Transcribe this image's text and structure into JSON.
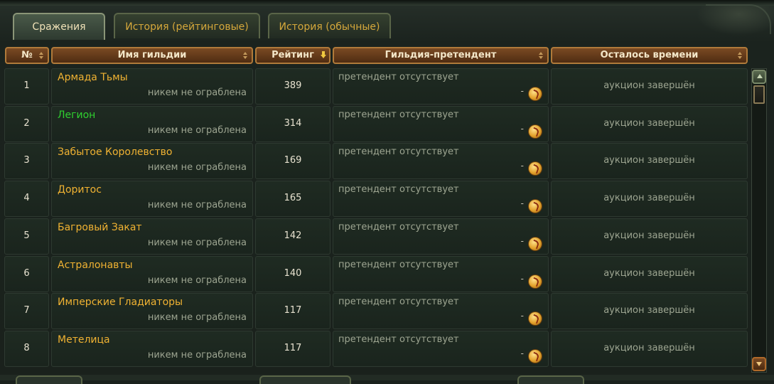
{
  "tabs": [
    {
      "label": "Сражения",
      "active": true
    },
    {
      "label": "История (рейтинговые)",
      "active": false
    },
    {
      "label": "История (обычные)",
      "active": false
    }
  ],
  "columns": {
    "num": "№",
    "guild": "Имя гильдии",
    "rating": "Рейтинг",
    "pretender": "Гильдия-претендент",
    "time_left": "Осталось времени"
  },
  "rows": [
    {
      "num": "1",
      "guild": "Армада Тьмы",
      "robbed": "никем не ограблена",
      "rating": "389",
      "pretender": "претендент отсутствует",
      "bid": "-",
      "time_left": "аукцион завершён",
      "guild_color": "gold"
    },
    {
      "num": "2",
      "guild": "Легион",
      "robbed": "никем не ограблена",
      "rating": "314",
      "pretender": "претендент отсутствует",
      "bid": "-",
      "time_left": "аукцион завершён",
      "guild_color": "green"
    },
    {
      "num": "3",
      "guild": "Забытое Королевство",
      "robbed": "никем не ограблена",
      "rating": "169",
      "pretender": "претендент отсутствует",
      "bid": "-",
      "time_left": "аукцион завершён",
      "guild_color": "gold"
    },
    {
      "num": "4",
      "guild": "Доритос",
      "robbed": "никем не ограблена",
      "rating": "165",
      "pretender": "претендент отсутствует",
      "bid": "-",
      "time_left": "аукцион завершён",
      "guild_color": "gold"
    },
    {
      "num": "5",
      "guild": "Багровый Закат",
      "robbed": "никем не ограблена",
      "rating": "142",
      "pretender": "претендент отсутствует",
      "bid": "-",
      "time_left": "аукцион завершён",
      "guild_color": "gold"
    },
    {
      "num": "6",
      "guild": "Астралонавты",
      "robbed": "никем не ограблена",
      "rating": "140",
      "pretender": "претендент отсутствует",
      "bid": "-",
      "time_left": "аукцион завершён",
      "guild_color": "gold"
    },
    {
      "num": "7",
      "guild": "Имперские Гладиаторы",
      "robbed": "никем не ограблена",
      "rating": "117",
      "pretender": "претендент отсутствует",
      "bid": "-",
      "time_left": "аукцион завершён",
      "guild_color": "gold"
    },
    {
      "num": "8",
      "guild": "Метелица",
      "robbed": "никем не ограблена",
      "rating": "117",
      "pretender": "претендент отсутствует",
      "bid": "-",
      "time_left": "аукцион завершён",
      "guild_color": "gold"
    }
  ],
  "colors": {
    "gold_name": "#f0b232",
    "green_name": "#2fd12f",
    "header_bg": "#6a3e1c",
    "muted_text": "#9da591"
  },
  "icons": {
    "coin": "gold-coin-icon",
    "sort": "sort-arrows-icon",
    "sort_active": "sort-down-arrow-icon"
  }
}
